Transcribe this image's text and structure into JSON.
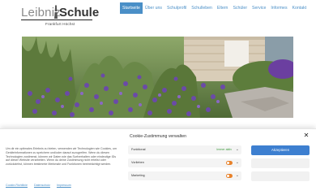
{
  "logo": {
    "word1": "Leibniz",
    "word2": "Schule",
    "subtitle": "Frankfurt Höchst"
  },
  "nav": {
    "items": [
      "Startseite",
      "Über uns",
      "Schulprofil",
      "Schulleben",
      "Eltern",
      "Schüler",
      "Service",
      "Informes",
      "Kontakt"
    ],
    "active_index": 0
  },
  "cookie": {
    "title": "Cookie-Zustimmung verwalten",
    "text": "Um dir ein optimales Erlebnis zu bieten, verwenden wir Technologien wie Cookies, um Geräteinformationen zu speichern und/oder darauf zuzugreifen. Wenn du diesen Technologien zustimmst, können wir Daten wie das Surfverhalten oder eindeutige IDs auf dieser Website verarbeiten. Wenn du deine Zustimmung nicht erteilst oder zurückziehst, können bestimmte Merkmale und Funktionen beeinträchtigt werden.",
    "categories": [
      {
        "label": "Funktional",
        "status": "Immer aktiv",
        "toggle": false
      },
      {
        "label": "Vorlieben",
        "status": "",
        "toggle": true
      },
      {
        "label": "Marketing",
        "status": "",
        "toggle": true
      }
    ],
    "buttons": {
      "accept": "Akzeptieren",
      "deny": "",
      "preferences": ""
    },
    "links": [
      "Cookie-Richtlinie",
      "Datenschutz",
      "Impressum"
    ]
  },
  "colors": {
    "accent": "#4a8fc7",
    "primary_button": "#3d7fd0",
    "toggle_off": "#e8822b",
    "status_active": "#3c9a3c"
  }
}
